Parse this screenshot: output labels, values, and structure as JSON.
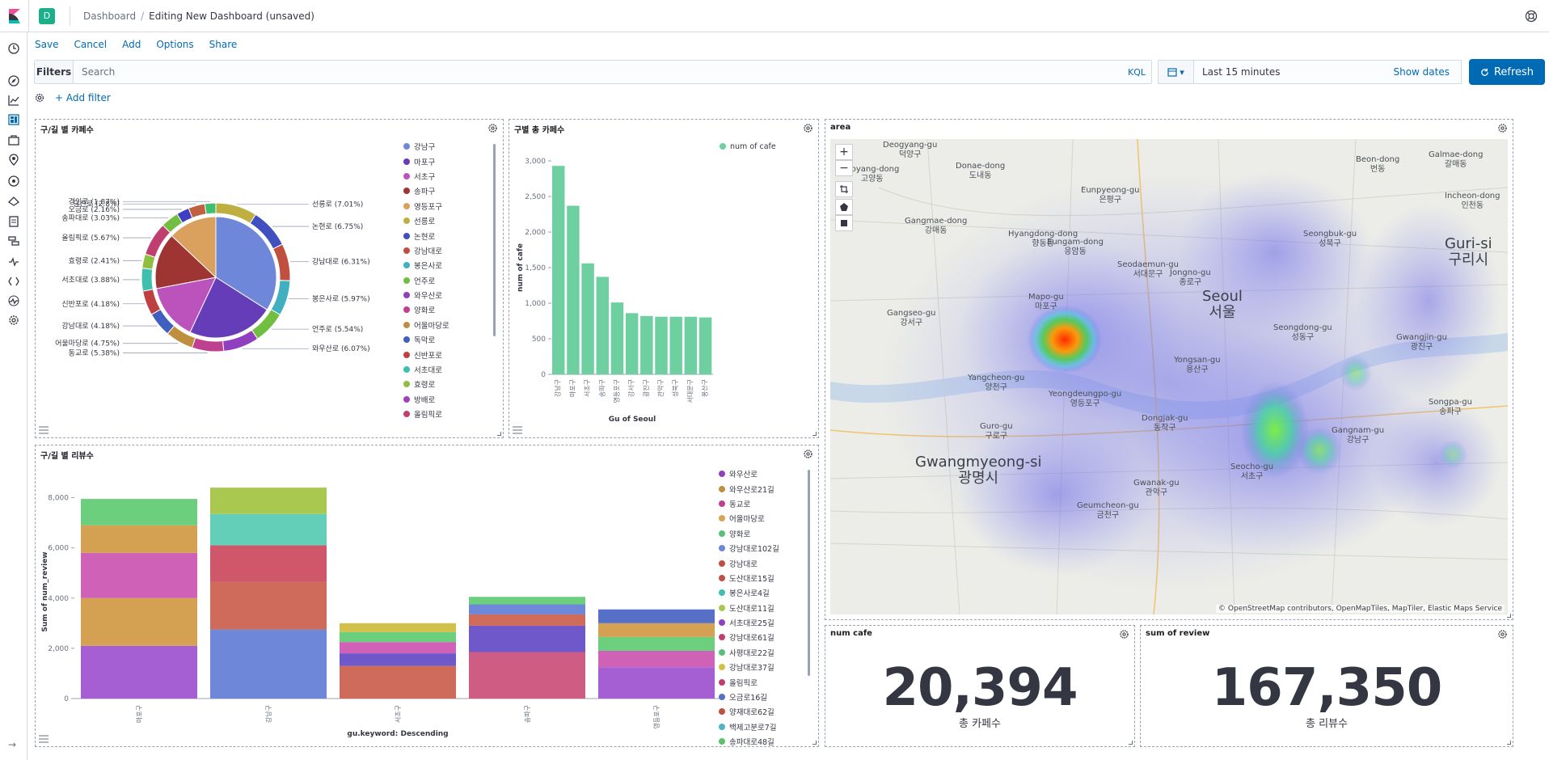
{
  "breadcrumbs": {
    "parent": "Dashboard",
    "current": "Editing New Dashboard (unsaved)"
  },
  "space": {
    "initial": "D"
  },
  "actions": [
    "Save",
    "Cancel",
    "Add",
    "Options",
    "Share"
  ],
  "query": {
    "filters_label": "Filters",
    "placeholder": "Search",
    "language": "KQL"
  },
  "time": {
    "range": "Last 15 minutes",
    "show_dates": "Show dates",
    "refresh": "Refresh"
  },
  "filter": {
    "add": "+ Add filter"
  },
  "colors": {
    "accent": "#006bb4",
    "space": "#1bb089"
  },
  "pie_panel": {
    "title": "구/길 별 카페수",
    "slice_labels": [
      "선릉로 (7.01%)",
      "논현로 (6.75%)",
      "강남대로 (6.31%)",
      "봉은사로 (5.97%)",
      "언주로 (5.54%)",
      "와우산로 (6.07%)",
      "동교로 (5.38%)",
      "경인로 (1.87%)",
      "당산로 (2.8%)",
      "오금로 (2.16%)",
      "송파대로 (3.03%)",
      "올림픽로 (5.67%)",
      "효령로 (2.41%)",
      "서초대로 (3.88%)",
      "신반포로 (4.18%)",
      "강남대로 (4.18%)",
      "어울마당로 (4.75%)"
    ],
    "legend": [
      {
        "label": "강남구",
        "color": "#6f87d8"
      },
      {
        "label": "마포구",
        "color": "#663db8"
      },
      {
        "label": "서초구",
        "color": "#bc52bc"
      },
      {
        "label": "송파구",
        "color": "#9e3533"
      },
      {
        "label": "영등포구",
        "color": "#daa05d"
      },
      {
        "label": "선릉로",
        "color": "#bfaf40"
      },
      {
        "label": "논현로",
        "color": "#4050bf"
      },
      {
        "label": "강남대로",
        "color": "#bf5040"
      },
      {
        "label": "봉은사로",
        "color": "#40afbf"
      },
      {
        "label": "언주로",
        "color": "#70bf40"
      },
      {
        "label": "와우산로",
        "color": "#9040bf"
      },
      {
        "label": "양화로",
        "color": "#bf4090"
      },
      {
        "label": "어울마당로",
        "color": "#bf8f40"
      },
      {
        "label": "독막로",
        "color": "#4060bf"
      },
      {
        "label": "신반포로",
        "color": "#bf4040"
      },
      {
        "label": "서초대로",
        "color": "#40bfaf"
      },
      {
        "label": "효령로",
        "color": "#8fbf40"
      },
      {
        "label": "방배로",
        "color": "#a040bf"
      },
      {
        "label": "올림픽로",
        "color": "#bf4070"
      }
    ]
  },
  "bar_panel": {
    "title": "구별 총 카페수",
    "legend": [
      {
        "label": "num of cafe",
        "color": "#6ed0a0"
      }
    ]
  },
  "stack_panel": {
    "title": "구/길 별 리뷰수",
    "legend": [
      {
        "label": "와우산로",
        "color": "#9040bf"
      },
      {
        "label": "와우산로21길",
        "color": "#bf8f40"
      },
      {
        "label": "동교로",
        "color": "#bf4090"
      },
      {
        "label": "어울마당로",
        "color": "#d9a555"
      },
      {
        "label": "양화로",
        "color": "#57c17b"
      },
      {
        "label": "강남대로102길",
        "color": "#6f87d8"
      },
      {
        "label": "강남대로",
        "color": "#bf5040"
      },
      {
        "label": "도산대로15길",
        "color": "#c14f45"
      },
      {
        "label": "봉은사로4길",
        "color": "#40bfaf"
      },
      {
        "label": "도산대로11길",
        "color": "#a8c850"
      },
      {
        "label": "서초대로25길",
        "color": "#9040bf"
      },
      {
        "label": "강남대로61길",
        "color": "#bf4070"
      },
      {
        "label": "사평대로22길",
        "color": "#57c17b"
      },
      {
        "label": "강남대로37길",
        "color": "#d2c04a"
      },
      {
        "label": "올림픽로",
        "color": "#bf4070"
      },
      {
        "label": "오금로16길",
        "color": "#5670c8"
      },
      {
        "label": "양재대로62길",
        "color": "#bf5040"
      },
      {
        "label": "백제고분로7길",
        "color": "#4fb3c8"
      },
      {
        "label": "송파대로48길",
        "color": "#5ec06a"
      }
    ]
  },
  "map_panel": {
    "title": "area",
    "attribution": "© OpenStreetMap contributors, OpenMapTiles, MapTiler, Elastic Maps Service",
    "controls": [
      "+",
      "−"
    ],
    "labels": [
      {
        "text": "Deogyang-gu\n덕양구"
      },
      {
        "text": "Donae-dong\n도내동"
      },
      {
        "text": "Goyang-dong\n고양동"
      },
      {
        "text": "Gangmae-dong\n강매동"
      },
      {
        "text": "Eunpyeong-gu\n은평구"
      },
      {
        "text": "Hyangdong-dong\n향동동"
      },
      {
        "text": "Eungam-dong\n응암동"
      },
      {
        "text": "Seodaemun-gu\n서대문구"
      },
      {
        "text": "Mapo-gu\n마포구"
      },
      {
        "text": "Seoul\n서울"
      },
      {
        "text": "Jongno-gu\n종로구"
      },
      {
        "text": "Seongbuk-gu\n성북구"
      },
      {
        "text": "Guri-si\n구리시"
      },
      {
        "text": "Gangseo-gu\n강서구"
      },
      {
        "text": "Yangcheon-gu\n양천구"
      },
      {
        "text": "Yeongdeungpo-gu\n영등포구"
      },
      {
        "text": "Yongsan-gu\n용산구"
      },
      {
        "text": "Seongdong-gu\n성동구"
      },
      {
        "text": "Gwangjin-gu\n광진구"
      },
      {
        "text": "Gangnam-gu\n강남구"
      },
      {
        "text": "Seocho-gu\n서초구"
      },
      {
        "text": "Guro-gu\n구로구"
      },
      {
        "text": "Gwangmyeong-si\n광명시"
      },
      {
        "text": "Dongjak-gu\n동작구"
      },
      {
        "text": "Gwanak-gu\n관악구"
      },
      {
        "text": "Geumcheon-gu\n금천구"
      },
      {
        "text": "Songpa-gu\n송파구"
      },
      {
        "text": "Galmae-dong\n갈매동"
      },
      {
        "text": "Incheon-dong\n인천동"
      },
      {
        "text": "Beon-dong\n번동"
      }
    ]
  },
  "metric_cafe": {
    "title": "num cafe",
    "value": "20,394",
    "label": "총 카페수"
  },
  "metric_review": {
    "title": "sum of review",
    "value": "167,350",
    "label": "총 리뷰수"
  },
  "chart_data": [
    {
      "type": "pie",
      "title": "구/길 별 카페수",
      "inner": {
        "categories": [
          "강남구",
          "마포구",
          "서초구",
          "송파구",
          "영등포구"
        ],
        "values": [
          34,
          23,
          15,
          15,
          13
        ]
      },
      "outer": {
        "categories": [
          "선릉로",
          "논현로",
          "강남대로",
          "봉은사로",
          "언주로",
          "와우산로",
          "동교로",
          "어울마당로",
          "강남대로",
          "신반포로",
          "서초대로",
          "효령로",
          "올림픽로",
          "송파대로",
          "오금로",
          "당산로",
          "경인로"
        ],
        "values": [
          7.01,
          6.75,
          6.31,
          5.97,
          5.54,
          6.07,
          5.38,
          4.75,
          4.18,
          4.18,
          3.88,
          2.41,
          5.67,
          3.03,
          2.16,
          2.8,
          1.87
        ]
      }
    },
    {
      "type": "bar",
      "title": "구별 총 카페수",
      "categories": [
        "강남구",
        "마포구",
        "서초구",
        "송파구",
        "영등포구",
        "강서구",
        "광진구",
        "관악구",
        "성북구",
        "서대문구",
        "용산구"
      ],
      "series": [
        {
          "name": "num of cafe",
          "values": [
            2930,
            2370,
            1560,
            1370,
            1010,
            860,
            820,
            810,
            810,
            810,
            800
          ]
        }
      ],
      "xlabel": "Gu of Seoul",
      "ylabel": "num of cafe",
      "ylim": [
        0,
        3000
      ],
      "yticks": [
        "0",
        "500",
        "1,000",
        "1,500",
        "2,000",
        "2,500",
        "3,000"
      ]
    },
    {
      "type": "bar",
      "stacked": true,
      "title": "구/길 별 리뷰수",
      "categories": [
        "마포구",
        "강남구",
        "서초구",
        "송파구",
        "영등포구"
      ],
      "xlabel": "gu.keyword: Descending",
      "ylabel": "Sum of num_review",
      "ylim": [
        0,
        8500
      ],
      "yticks": [
        "0",
        "2,000",
        "4,000",
        "6,000",
        "8,000"
      ],
      "stacks": [
        [
          {
            "v": 2100,
            "c": "#a65fd2"
          },
          {
            "v": 1900,
            "c": "#d4a052"
          },
          {
            "v": 1800,
            "c": "#cf62b6"
          },
          {
            "v": 1100,
            "c": "#d4a052"
          },
          {
            "v": 1050,
            "c": "#6ccf7e"
          }
        ],
        [
          {
            "v": 2750,
            "c": "#6f87d8"
          },
          {
            "v": 1900,
            "c": "#cf6b5a"
          },
          {
            "v": 1450,
            "c": "#d0566a"
          },
          {
            "v": 1250,
            "c": "#64cfb9"
          },
          {
            "v": 1050,
            "c": "#a8c850"
          }
        ],
        [
          {
            "v": 1300,
            "c": "#cf6b5a"
          },
          {
            "v": 500,
            "c": "#6f58c9"
          },
          {
            "v": 450,
            "c": "#cf62b6"
          },
          {
            "v": 400,
            "c": "#6ccf7e"
          },
          {
            "v": 350,
            "c": "#d2c04a"
          }
        ],
        [
          {
            "v": 1850,
            "c": "#cf5c83"
          },
          {
            "v": 1050,
            "c": "#6f58c9"
          },
          {
            "v": 450,
            "c": "#cf6b5a"
          },
          {
            "v": 400,
            "c": "#6f87d8"
          },
          {
            "v": 300,
            "c": "#6ccf7e"
          }
        ],
        [
          {
            "v": 1250,
            "c": "#a65fd2"
          },
          {
            "v": 650,
            "c": "#cf62b6"
          },
          {
            "v": 550,
            "c": "#6ccf7e"
          },
          {
            "v": 550,
            "c": "#d4a052"
          },
          {
            "v": 550,
            "c": "#5670c8"
          }
        ]
      ]
    }
  ]
}
